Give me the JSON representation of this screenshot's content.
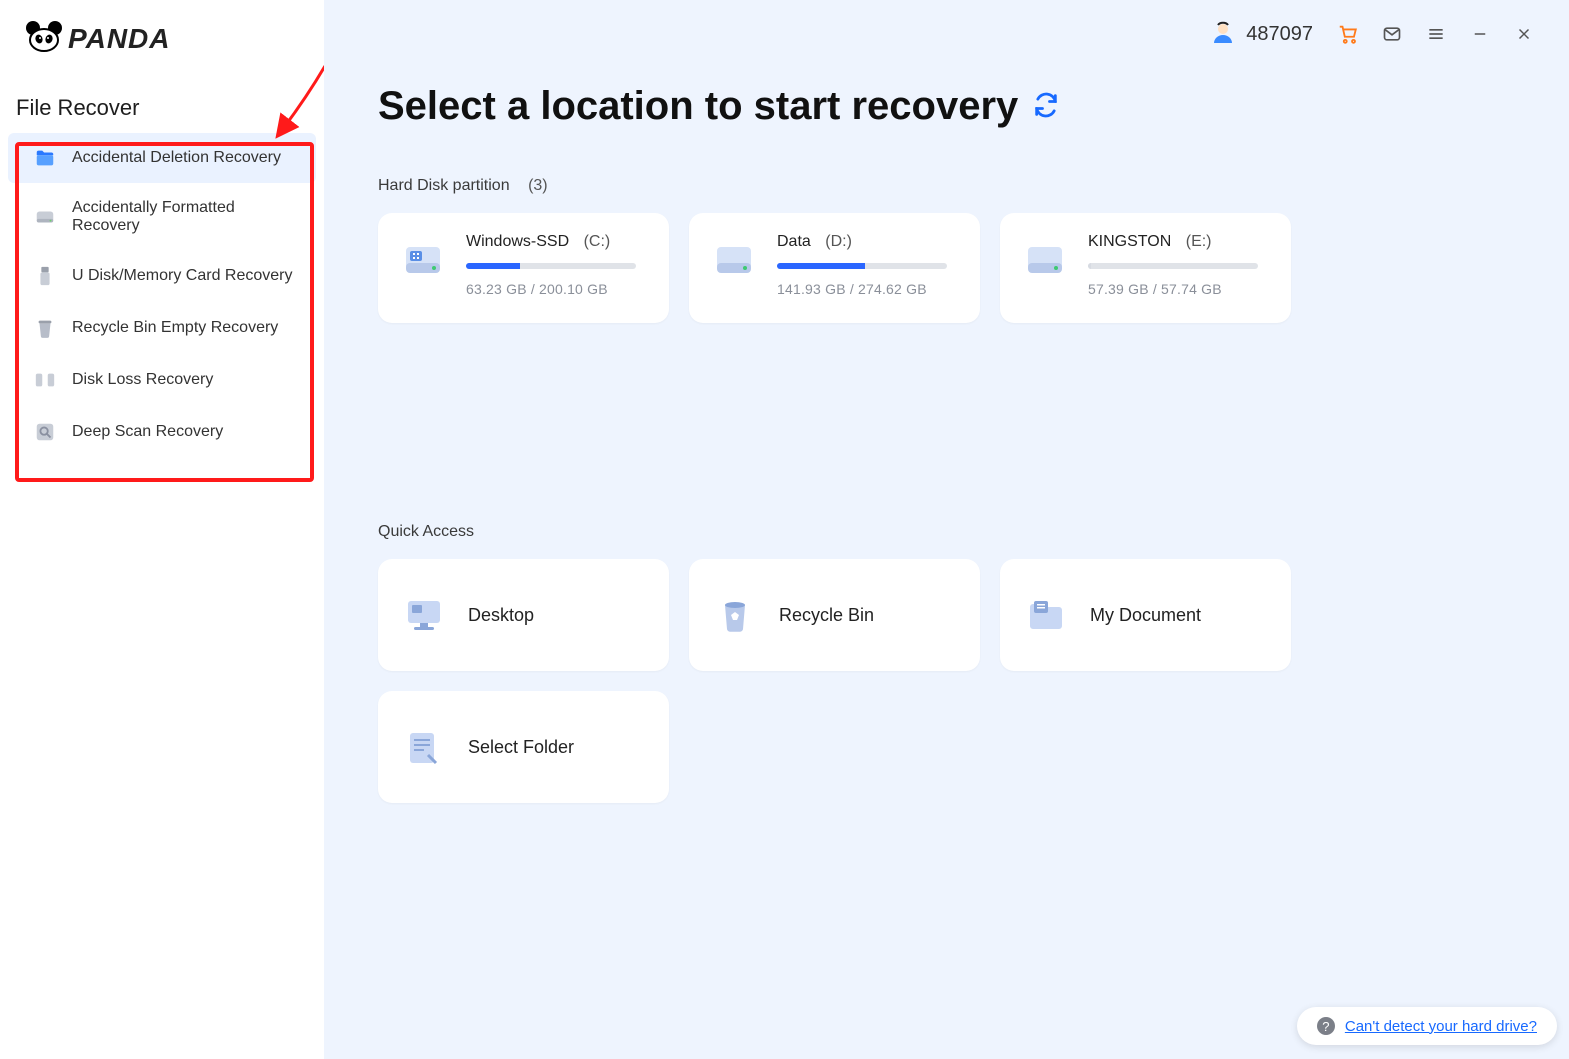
{
  "brand": {
    "name": "PANDA"
  },
  "sidebar": {
    "title": "File Recover",
    "items": [
      {
        "label": "Accidental Deletion Recovery",
        "icon": "folder-icon",
        "active": true
      },
      {
        "label": "Accidentally Formatted Recovery",
        "icon": "drive-icon"
      },
      {
        "label": "U Disk/Memory Card Recovery",
        "icon": "usb-icon"
      },
      {
        "label": "Recycle Bin Empty Recovery",
        "icon": "bin-icon"
      },
      {
        "label": "Disk Loss Recovery",
        "icon": "split-disks-icon"
      },
      {
        "label": "Deep Scan Recovery",
        "icon": "scan-icon"
      }
    ]
  },
  "header": {
    "user_id": "487097",
    "icons": {
      "cart": "cart-icon",
      "mail": "mail-icon",
      "menu": "menu-icon",
      "minimize": "minimize-icon",
      "close": "close-icon"
    }
  },
  "main": {
    "title": "Select a location to start recovery",
    "partition_label": "Hard Disk partition",
    "partition_count": "(3)",
    "partitions": [
      {
        "name": "Windows-SSD",
        "letter": "(C:)",
        "used": "63.23 GB",
        "total": "200.10 GB",
        "usage": "63.23 GB / 200.10 GB",
        "pct": 31.6
      },
      {
        "name": "Data",
        "letter": "(D:)",
        "used": "141.93 GB",
        "total": "274.62 GB",
        "usage": "141.93 GB / 274.62 GB",
        "pct": 51.7
      },
      {
        "name": "KINGSTON",
        "letter": "(E:)",
        "used": "57.39 GB",
        "total": "57.74 GB",
        "usage": "57.39 GB / 57.74 GB",
        "pct": 2.0,
        "fill_color": "#d7dbe2"
      }
    ],
    "quick_label": "Quick Access",
    "quick": [
      {
        "label": "Desktop",
        "icon": "desktop-icon"
      },
      {
        "label": "Recycle Bin",
        "icon": "bin-large-icon"
      },
      {
        "label": "My Document",
        "icon": "folder-doc-icon"
      },
      {
        "label": "Select Folder",
        "icon": "select-folder-icon"
      }
    ],
    "help_link": "Can't detect your hard drive?"
  }
}
